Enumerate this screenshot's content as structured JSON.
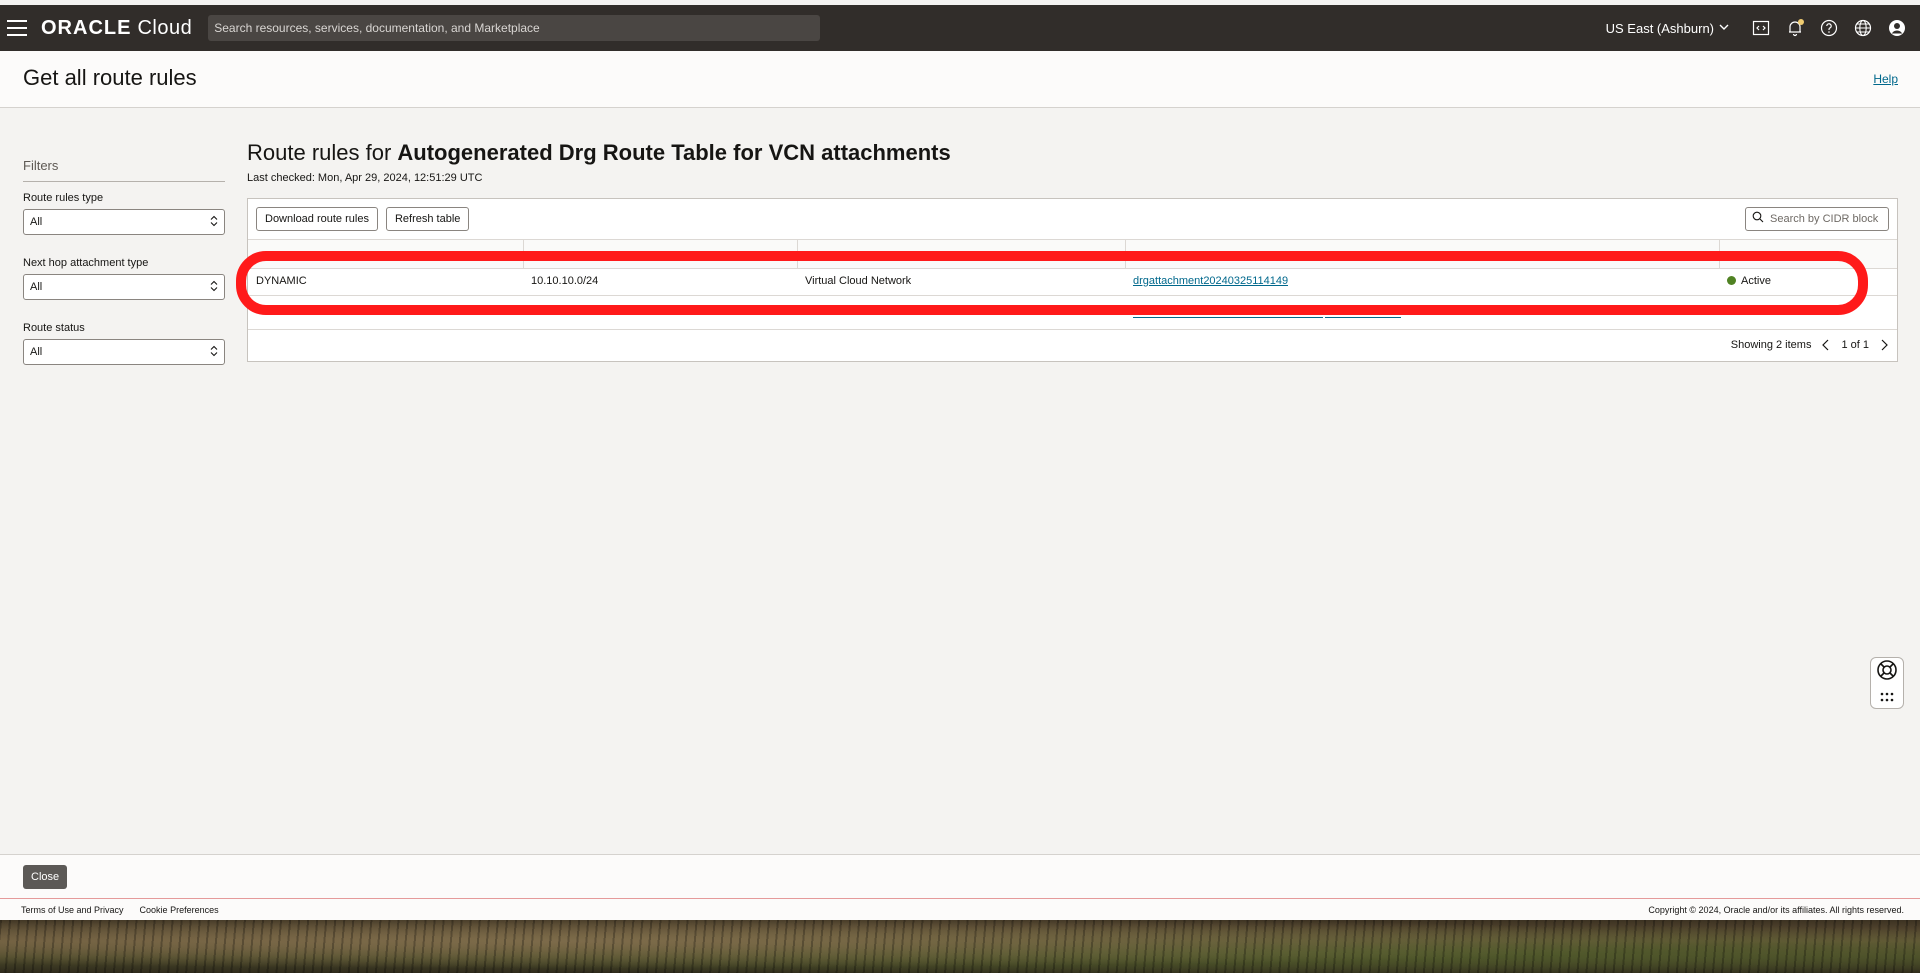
{
  "topbar": {
    "brand_main": "ORACLE",
    "brand_sub": "Cloud",
    "search_placeholder": "Search resources, services, documentation, and Marketplace",
    "region": "US East (Ashburn)",
    "icons": [
      "code-editor-icon",
      "bell-icon",
      "help-circle-icon",
      "globe-icon",
      "user-avatar-icon"
    ]
  },
  "header": {
    "title": "Get all route rules",
    "help_label": "Help"
  },
  "filters": {
    "title": "Filters",
    "groups": [
      {
        "label": "Route rules type",
        "value": "All"
      },
      {
        "label": "Next hop attachment type",
        "value": "All"
      },
      {
        "label": "Route status",
        "value": "All"
      }
    ]
  },
  "main": {
    "title_prefix": "Route rules for ",
    "title_bold": "Autogenerated Drg Route Table for VCN attachments",
    "last_checked": "Last checked: Mon, Apr 29, 2024, 12:51:29 UTC",
    "download_label": "Download route rules",
    "refresh_label": "Refresh table",
    "cidr_placeholder": "Search by CIDR block",
    "rows": [
      {
        "type": "DYNAMIC",
        "cidr": "10.10.10.0/24",
        "next_hop_type": "Virtual Cloud Network",
        "attachment": "drgattachment20240325114149",
        "status": "Active"
      }
    ],
    "showing": "Showing 2 items",
    "page": "1 of 1"
  },
  "footer": {
    "close_label": "Close",
    "terms": "Terms of Use and Privacy",
    "cookies": "Cookie Preferences",
    "copyright": "Copyright © 2024, Oracle and/or its affiliates. All rights reserved."
  },
  "colors": {
    "topbar_bg": "#312d2a",
    "link": "#00688c",
    "status_active": "#508223",
    "highlight": "#ff1a1a"
  }
}
